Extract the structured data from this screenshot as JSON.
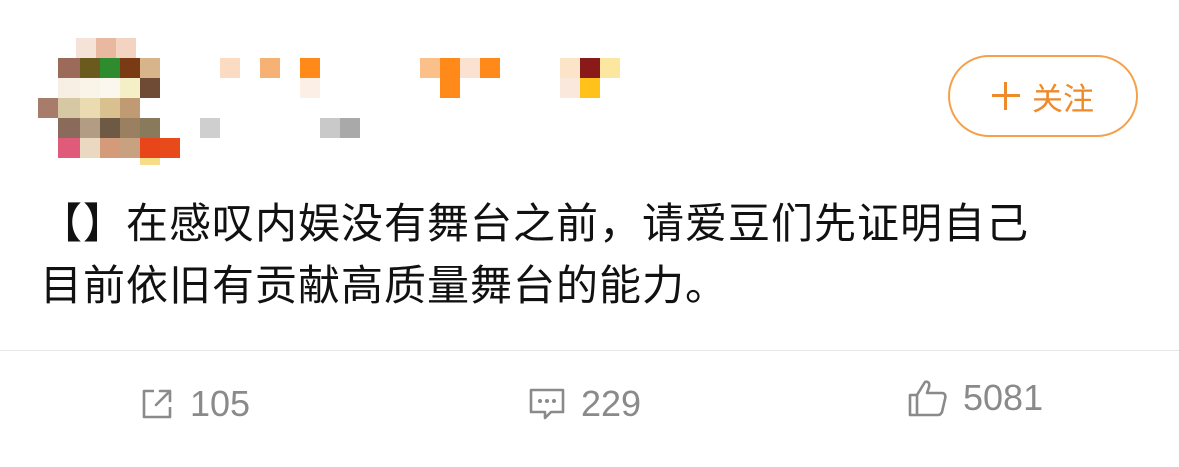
{
  "post": {
    "text_line1": "【】在感叹内娱没有舞台之前，请爱豆们先证明自己",
    "text_line2": "目前依旧有贡献高质量舞台的能力。"
  },
  "follow_button": {
    "label": "关注",
    "icon": "plus-icon"
  },
  "actions": {
    "repost": {
      "icon": "share-icon",
      "count": "105"
    },
    "comment": {
      "icon": "comment-icon",
      "count": "229"
    },
    "like": {
      "icon": "thumbs-up-icon",
      "count": "5081"
    }
  },
  "colors": {
    "accent": "#ee8a2a",
    "border": "#f5a04a",
    "muted": "#8a8a8a"
  }
}
